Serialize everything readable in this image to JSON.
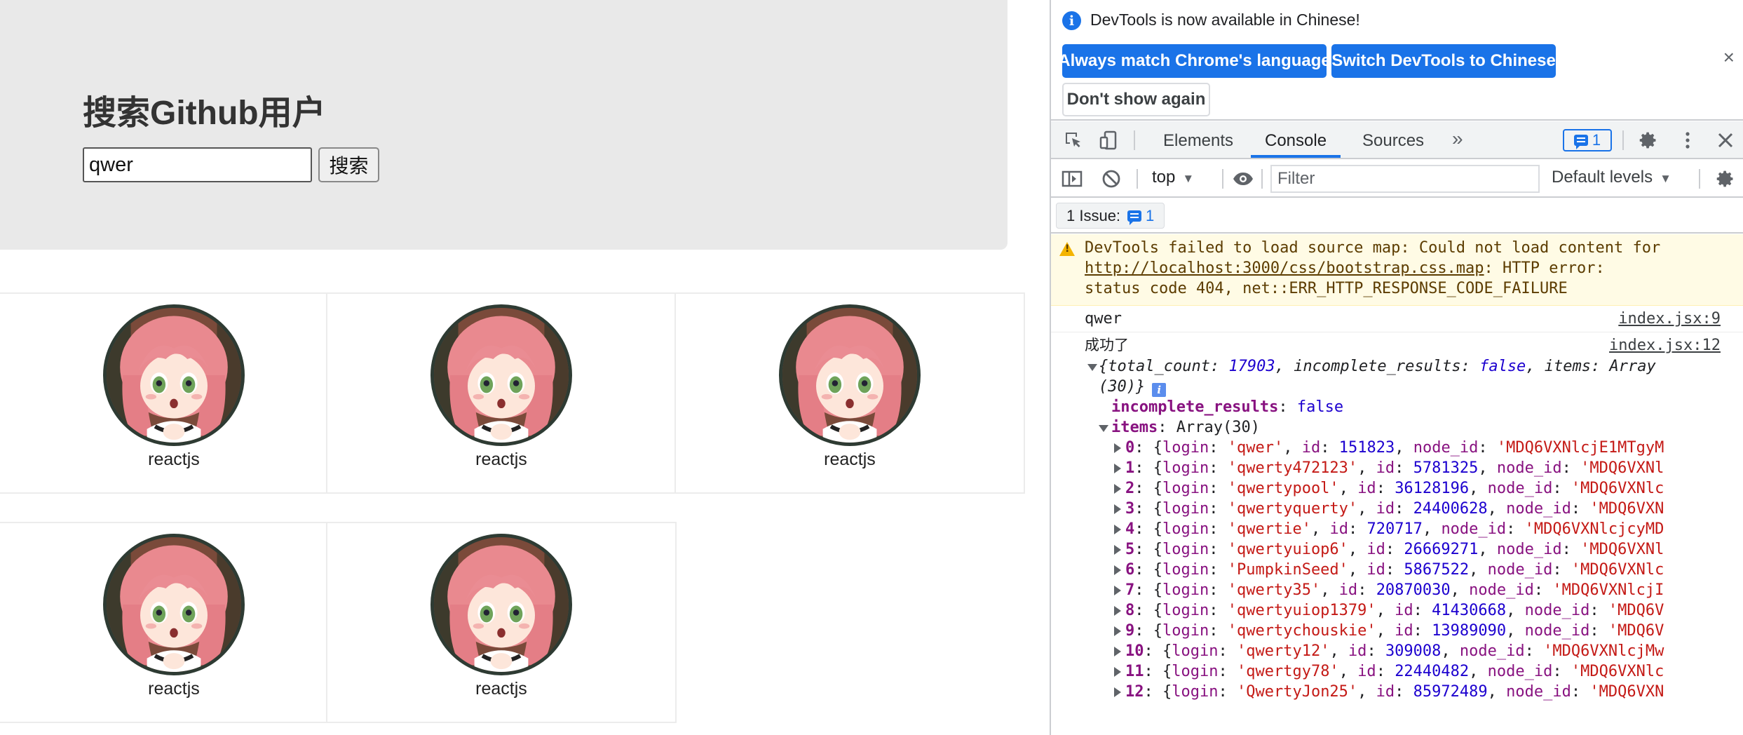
{
  "page": {
    "title": "搜索Github用户",
    "search_value": "qwer",
    "search_button": "搜索",
    "users": [
      {
        "name": "reactjs"
      },
      {
        "name": "reactjs"
      },
      {
        "name": "reactjs"
      },
      {
        "name": "reactjs"
      },
      {
        "name": "reactjs"
      }
    ]
  },
  "devtools": {
    "infobar": {
      "message": "DevTools is now available in Chinese!",
      "btn_match": "Always match Chrome's language",
      "btn_switch": "Switch DevTools to Chinese",
      "btn_dismiss": "Don't show again",
      "close": "×"
    },
    "tabs": [
      {
        "label": "Elements"
      },
      {
        "label": "Console"
      },
      {
        "label": "Sources"
      }
    ],
    "more_tabs": "»",
    "issue_count": "1",
    "context": "top",
    "filter_placeholder": "Filter",
    "levels": "Default levels",
    "issues_label": "1 Issue:",
    "issues_count": "1",
    "console": {
      "warning": {
        "line1": "DevTools failed to load source map: Could not load content for",
        "url": "http://localhost:3000/css/bootstrap.css.map",
        "line2_rest": ": HTTP error:",
        "line3": "status code 404, net::ERR_HTTP_RESPONSE_CODE_FAILURE"
      },
      "log1": {
        "text": "qwer",
        "source": "index.jsx:9"
      },
      "log2": {
        "text": "成功了",
        "source": "index.jsx:12"
      },
      "object": {
        "summary_a": "{total_count: ",
        "total_count": "17903",
        "summary_b": ", incomplete_results: ",
        "incomplete_results": "false",
        "summary_c": ", items: Array",
        "summary_d": "(30)}",
        "incomplete_key": "incomplete_results",
        "items_key": "items",
        "items_value": "Array(30)",
        "items": [
          {
            "idx": "0",
            "login": "'qwer'",
            "id": "151823",
            "node_id": "'MDQ6VXNlcjE1MTgyM"
          },
          {
            "idx": "1",
            "login": "'qwerty472123'",
            "id": "5781325",
            "node_id": "'MDQ6VXNl"
          },
          {
            "idx": "2",
            "login": "'qwertypool'",
            "id": "36128196",
            "node_id": "'MDQ6VXNlc"
          },
          {
            "idx": "3",
            "login": "'qwertyquerty'",
            "id": "24400628",
            "node_id": "'MDQ6VXN"
          },
          {
            "idx": "4",
            "login": "'qwertie'",
            "id": "720717",
            "node_id": "'MDQ6VXNlcjcyMD"
          },
          {
            "idx": "5",
            "login": "'qwertyuiop6'",
            "id": "26669271",
            "node_id": "'MDQ6VXNl"
          },
          {
            "idx": "6",
            "login": "'PumpkinSeed'",
            "id": "5867522",
            "node_id": "'MDQ6VXNlc"
          },
          {
            "idx": "7",
            "login": "'qwerty35'",
            "id": "20870030",
            "node_id": "'MDQ6VXNlcjI"
          },
          {
            "idx": "8",
            "login": "'qwertyuiop1379'",
            "id": "41430668",
            "node_id": "'MDQ6V"
          },
          {
            "idx": "9",
            "login": "'qwertychouskie'",
            "id": "13989090",
            "node_id": "'MDQ6V"
          },
          {
            "idx": "10",
            "login": "'qwerty12'",
            "id": "309008",
            "node_id": "'MDQ6VXNlcjMw"
          },
          {
            "idx": "11",
            "login": "'qwertgy78'",
            "id": "22440482",
            "node_id": "'MDQ6VXNlc"
          },
          {
            "idx": "12",
            "login": "'QwertyJon25'",
            "id": "85972489",
            "node_id": "'MDQ6VXN"
          }
        ]
      }
    }
  },
  "colors": {
    "accent": "#1a73e8",
    "warning_bg": "#fffbe5",
    "jumbotron_bg": "#e9e9e9"
  }
}
